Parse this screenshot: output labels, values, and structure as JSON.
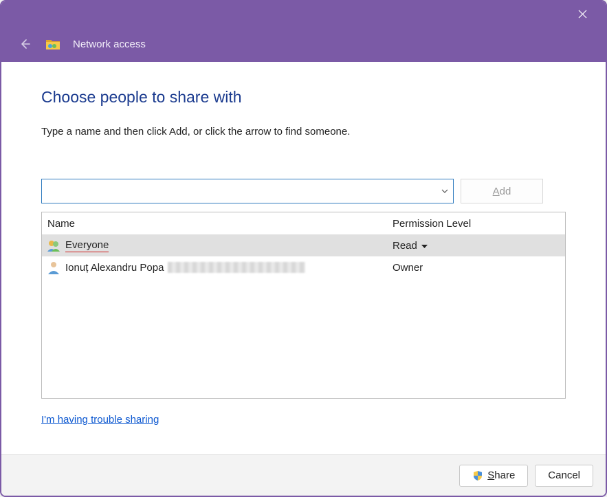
{
  "titlebar": {
    "nav_title": "Network access"
  },
  "main": {
    "heading": "Choose people to share with",
    "instruction": "Type a name and then click Add, or click the arrow to find someone.",
    "name_input_value": "",
    "add_label_prefix": "A",
    "add_label_rest": "dd"
  },
  "table": {
    "headers": {
      "name": "Name",
      "permission": "Permission Level"
    },
    "rows": [
      {
        "name": "Everyone",
        "permission": "Read",
        "selected": true,
        "icon": "group",
        "has_dropdown": true,
        "redacted": false
      },
      {
        "name": "Ionuț Alexandru Popa",
        "permission": "Owner",
        "selected": false,
        "icon": "user",
        "has_dropdown": false,
        "redacted": true
      }
    ]
  },
  "links": {
    "trouble": "I'm having trouble sharing"
  },
  "footer": {
    "share_u": "S",
    "share_rest": "hare",
    "cancel": "Cancel"
  }
}
